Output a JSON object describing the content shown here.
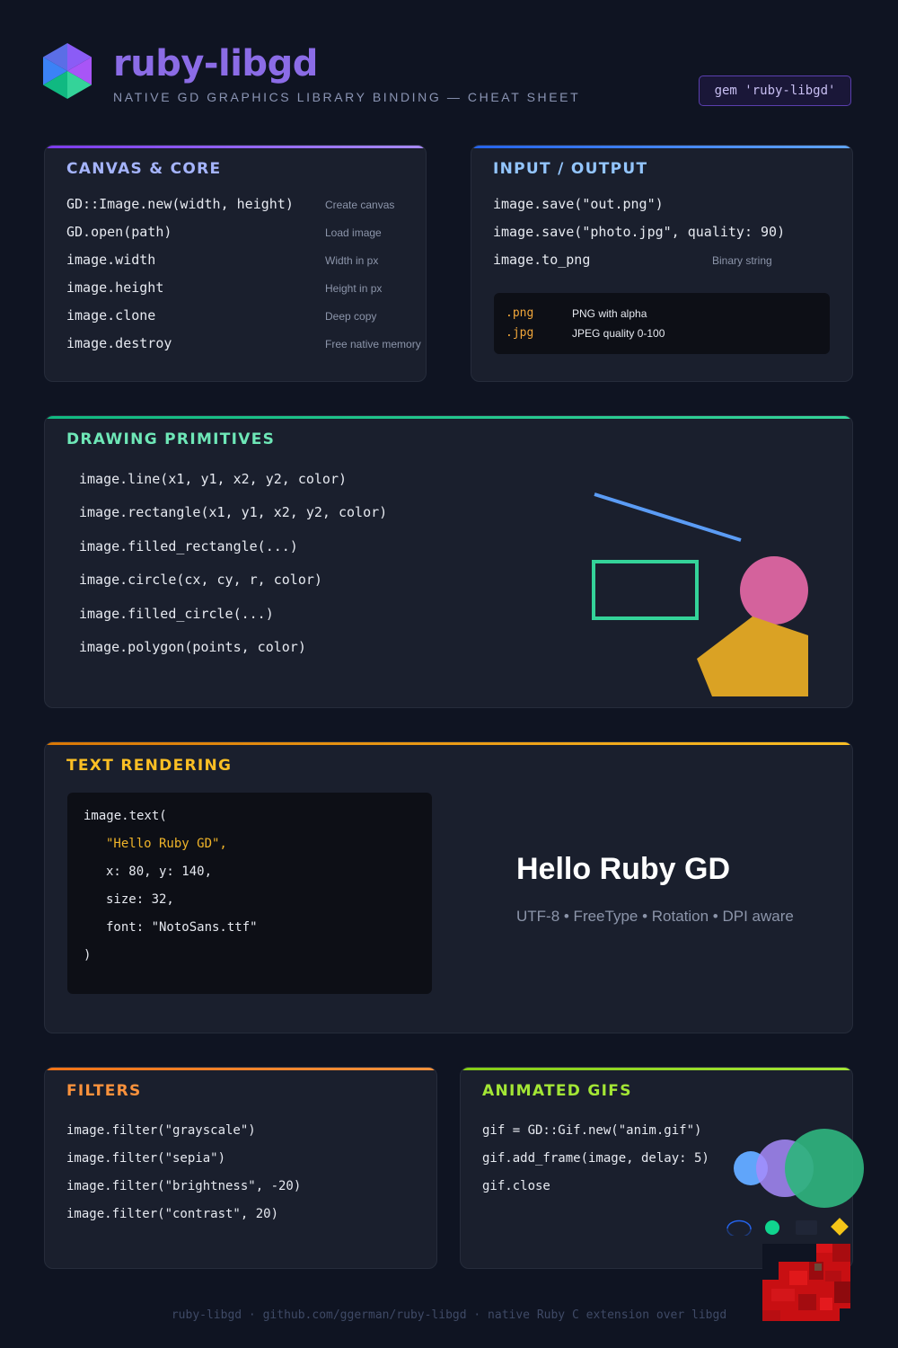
{
  "header": {
    "title": "ruby-libgd",
    "subtitle": "NATIVE GD GRAPHICS LIBRARY BINDING — CHEAT SHEET",
    "gem": "gem 'ruby-libgd'",
    "logo_icon": "hexagon-cube-icon"
  },
  "canvas": {
    "title": "CANVAS & CORE",
    "accent": "#7c5ce0",
    "rows": [
      {
        "code": "GD::Image.new(width, height)",
        "desc": "Create canvas"
      },
      {
        "code": "GD.open(path)",
        "desc": "Load image"
      },
      {
        "code": "image.width",
        "desc": "Width in px"
      },
      {
        "code": "image.height",
        "desc": "Height in px"
      },
      {
        "code": "image.clone",
        "desc": "Deep copy"
      },
      {
        "code": "image.destroy",
        "desc": "Free native memory"
      }
    ]
  },
  "io": {
    "title": "INPUT / OUTPUT",
    "accent": "#3b82f6",
    "rows": [
      {
        "code": "image.save(\"out.png\")",
        "desc": ""
      },
      {
        "code": "image.save(\"photo.jpg\", quality: 90)",
        "desc": ""
      },
      {
        "code": "image.to_png",
        "desc": "Binary string"
      }
    ],
    "formats": [
      {
        "ext": ".png",
        "desc": "PNG with alpha"
      },
      {
        "ext": ".jpg",
        "desc": "JPEG quality 0-100"
      }
    ]
  },
  "drawing": {
    "title": "DRAWING PRIMITIVES",
    "accent": "#34d399",
    "rows": [
      "image.line(x1, y1, x2, y2, color)",
      "image.rectangle(x1, y1, x2, y2, color)",
      "image.filled_rectangle(...)",
      "image.circle(cx, cy, r, color)",
      "image.filled_circle(...)",
      "image.polygon(points, color)"
    ],
    "colors": {
      "line": "#5b9cf5",
      "rect": "#34d399",
      "circle": "#d4629c",
      "polygon": "#daa224"
    }
  },
  "text": {
    "title": "TEXT RENDERING",
    "accent": "#f0b429",
    "code": {
      "l1": "image.text(",
      "l2": "\"Hello Ruby GD\",",
      "l3": "x: 80, y: 140,",
      "l4": "size: 32,",
      "l5": "font: \"NotoSans.ttf\"",
      "l6": ")"
    },
    "preview_title": "Hello Ruby GD",
    "preview_caption": "UTF-8 • FreeType • Rotation • DPI aware"
  },
  "filters": {
    "title": "FILTERS",
    "accent": "#f59e54",
    "rows": [
      "image.filter(\"grayscale\")",
      "image.filter(\"sepia\")",
      "image.filter(\"brightness\", -20)",
      "image.filter(\"contrast\", 20)"
    ]
  },
  "gifs": {
    "title": "ANIMATED GIFS",
    "accent": "#a3e635",
    "rows": [
      "gif = GD::Gif.new(\"anim.gif\")",
      "gif.add_frame(image, delay: 5)",
      "gif.close"
    ]
  },
  "footer": "ruby-libgd · github.com/ggerman/ruby-libgd · native Ruby C extension over libgd"
}
